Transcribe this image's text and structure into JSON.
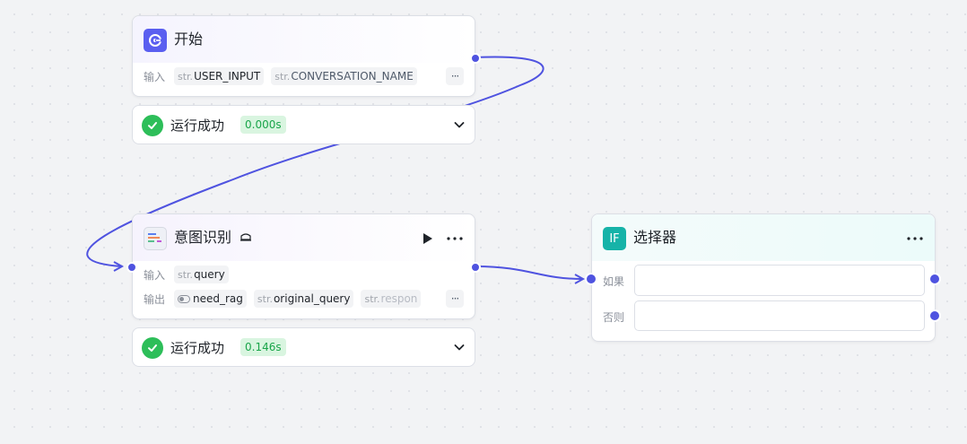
{
  "colors": {
    "accent": "#4f53e0",
    "success": "#2dbe59",
    "success_text": "#1aa54a",
    "success_bg": "#d9f5e0",
    "selector_icon": "#16b3a8"
  },
  "start_node": {
    "title": "开始",
    "icon": "start-icon",
    "input_label": "输入",
    "inputs": [
      {
        "type": "str.",
        "name": "USER_INPUT"
      },
      {
        "type": "str.",
        "name": "CONVERSATION_NAME"
      }
    ],
    "more": "···"
  },
  "start_status": {
    "text": "运行成功",
    "time": "0.000s"
  },
  "intent_node": {
    "title": "意图识别",
    "icon": "intent-recognition-icon",
    "input_label": "输入",
    "inputs": [
      {
        "type": "str.",
        "name": "query"
      }
    ],
    "output_label": "输出",
    "outputs": [
      {
        "type": "toggle",
        "name": "need_rag"
      },
      {
        "type": "str.",
        "name": "original_query"
      },
      {
        "type": "str.",
        "name": "respon"
      }
    ],
    "more": "···"
  },
  "intent_status": {
    "text": "运行成功",
    "time": "0.146s"
  },
  "selector_node": {
    "title": "选择器",
    "icon_text": "IF",
    "condition_if": "如果",
    "condition_else": "否则",
    "if_value": "",
    "else_value": ""
  }
}
